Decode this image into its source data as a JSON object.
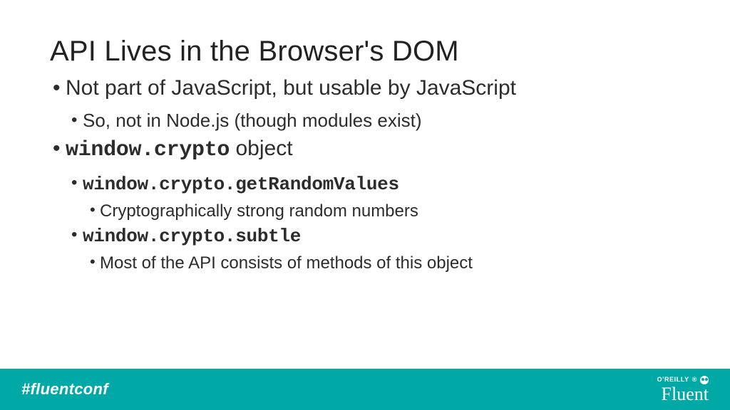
{
  "title": "API Lives in the Browser's DOM",
  "bullets": {
    "b1_1": "Not part of JavaScript, but usable by JavaScript",
    "b2_1": "So, not in Node.js (though modules exist)",
    "b1_2_code": "window.crypto",
    "b1_2_rest": " object",
    "b2_2_code": "window.crypto.getRandomValues",
    "b3_1": "Cryptographically strong random numbers",
    "b2_3_code": "window.crypto.subtle",
    "b3_2": "Most of the API consists of methods of this object"
  },
  "footer": {
    "hashtag": "#fluentconf",
    "publisher": "O'REILLY",
    "reg": "®",
    "confname": "Fluent"
  }
}
